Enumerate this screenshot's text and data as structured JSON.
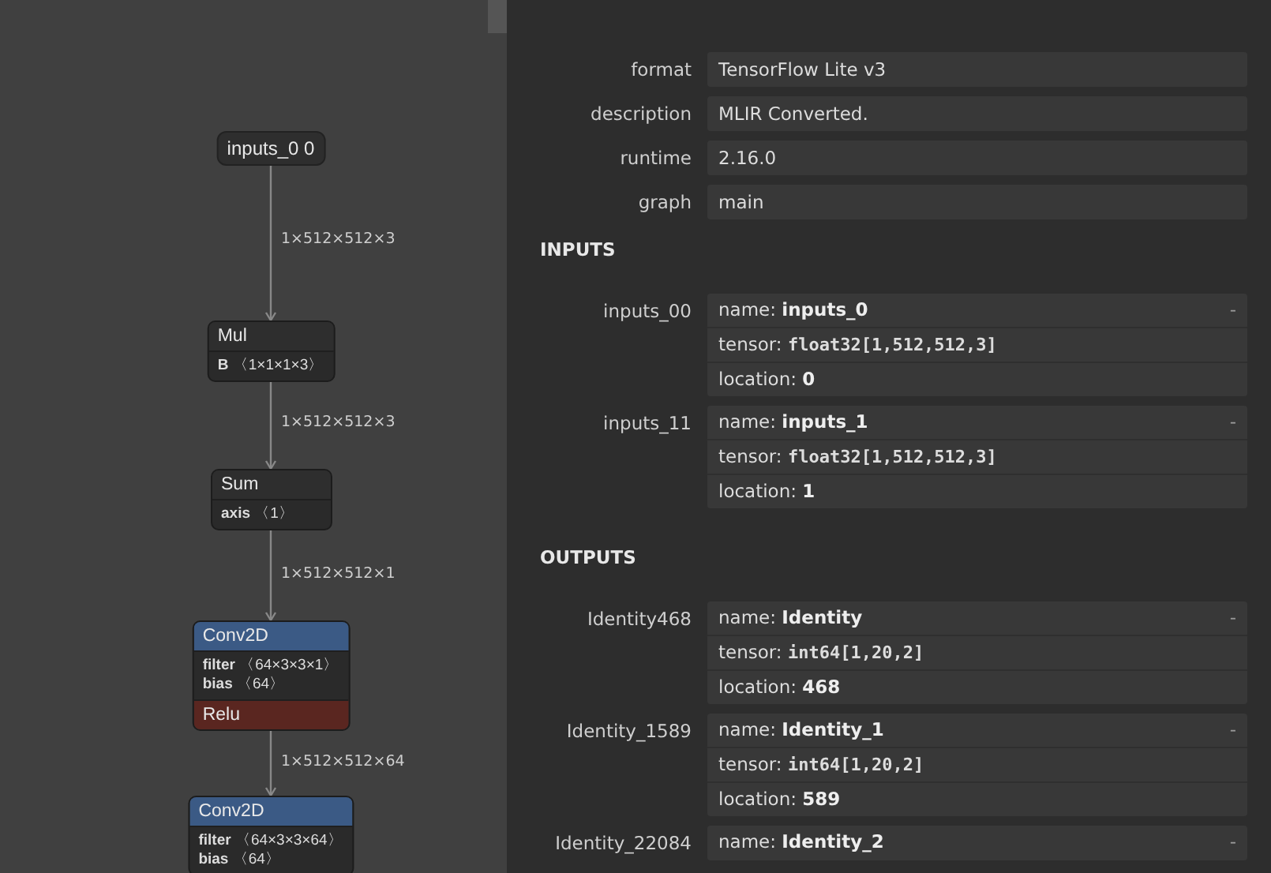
{
  "graph": {
    "nodes": [
      {
        "kind": "input",
        "title": "inputs_0 0"
      },
      {
        "kind": "op",
        "color": "#2e2e2e",
        "title": "Mul",
        "attributes": [
          {
            "name": "B",
            "value": "〈1×1×1×3〉"
          }
        ]
      },
      {
        "kind": "op",
        "color": "#2e2e2e",
        "title": "Sum",
        "attributes": [
          {
            "name": "axis",
            "value": "〈1〉"
          }
        ]
      },
      {
        "kind": "op",
        "color": "#3b5a85",
        "title": "Conv2D",
        "attributes": [
          {
            "name": "filter",
            "value": "〈64×3×3×1〉"
          },
          {
            "name": "bias",
            "value": "〈64〉"
          }
        ],
        "activation": "Relu"
      },
      {
        "kind": "op",
        "color": "#3b5a85",
        "title": "Conv2D",
        "attributes": [
          {
            "name": "filter",
            "value": "〈64×3×3×64〉"
          },
          {
            "name": "bias",
            "value": "〈64〉"
          }
        ]
      }
    ],
    "edges": [
      {
        "label": "1×512×512×3"
      },
      {
        "label": "1×512×512×3"
      },
      {
        "label": "1×512×512×1"
      },
      {
        "label": "1×512×512×64"
      }
    ]
  },
  "properties": {
    "model": [
      {
        "label": "format",
        "value": "TensorFlow Lite v3"
      },
      {
        "label": "description",
        "value": "MLIR Converted."
      },
      {
        "label": "runtime",
        "value": "2.16.0"
      },
      {
        "label": "graph",
        "value": "main"
      }
    ],
    "sections": [
      {
        "title": "INPUTS",
        "items": [
          {
            "label": "inputs_00",
            "toggle": "-",
            "fields": [
              {
                "kind": "text",
                "name": "name:",
                "value": "inputs_0"
              },
              {
                "kind": "code",
                "name": "tensor:",
                "value": "float32[1,512,512,3]"
              },
              {
                "kind": "text",
                "name": "location:",
                "value": "0"
              }
            ]
          },
          {
            "label": "inputs_11",
            "toggle": "-",
            "fields": [
              {
                "kind": "text",
                "name": "name:",
                "value": "inputs_1"
              },
              {
                "kind": "code",
                "name": "tensor:",
                "value": "float32[1,512,512,3]"
              },
              {
                "kind": "text",
                "name": "location:",
                "value": "1"
              }
            ]
          }
        ]
      },
      {
        "title": "OUTPUTS",
        "items": [
          {
            "label": "Identity468",
            "toggle": "-",
            "fields": [
              {
                "kind": "text",
                "name": "name:",
                "value": "Identity"
              },
              {
                "kind": "code",
                "name": "tensor:",
                "value": "int64[1,20,2]"
              },
              {
                "kind": "text",
                "name": "location:",
                "value": "468"
              }
            ]
          },
          {
            "label": "Identity_1589",
            "toggle": "-",
            "fields": [
              {
                "kind": "text",
                "name": "name:",
                "value": "Identity_1"
              },
              {
                "kind": "code",
                "name": "tensor:",
                "value": "int64[1,20,2]"
              },
              {
                "kind": "text",
                "name": "location:",
                "value": "589"
              }
            ]
          },
          {
            "label": "Identity_22084",
            "toggle": "-",
            "fields": [
              {
                "kind": "text",
                "name": "name:",
                "value": "Identity_2"
              }
            ]
          }
        ]
      }
    ]
  }
}
